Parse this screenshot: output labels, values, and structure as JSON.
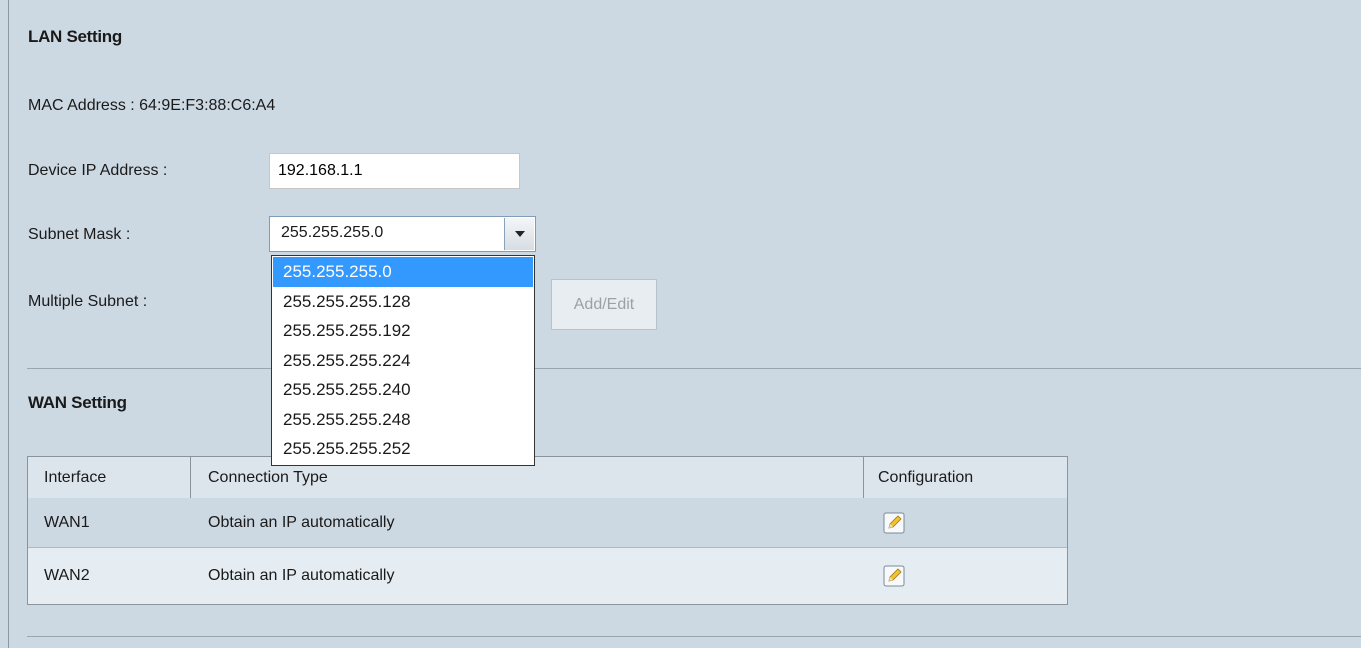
{
  "lan": {
    "title": "LAN Setting",
    "mac_label": "MAC Address : 64:9E:F3:88:C6:A4",
    "device_ip_label": "Device IP Address :",
    "device_ip_value": "192.168.1.1",
    "subnet_mask_label": "Subnet Mask :",
    "subnet_mask_value": "255.255.255.0",
    "subnet_options": [
      "255.255.255.0",
      "255.255.255.128",
      "255.255.255.192",
      "255.255.255.224",
      "255.255.255.240",
      "255.255.255.248",
      "255.255.255.252"
    ],
    "multiple_subnet_label": "Multiple Subnet  :",
    "add_edit_label": "Add/Edit"
  },
  "wan": {
    "title": "WAN Setting",
    "columns": [
      "Interface",
      "Connection Type",
      "Configuration"
    ],
    "rows": [
      {
        "interface": "WAN1",
        "connection_type": "Obtain an IP automatically",
        "configuration_icon": "pencil-edit-icon"
      },
      {
        "interface": "WAN2",
        "connection_type": "Obtain an IP automatically",
        "configuration_icon": "pencil-edit-icon"
      }
    ]
  },
  "colors": {
    "background": "#ccd8e2",
    "dropdown_selected": "#3399ff"
  }
}
